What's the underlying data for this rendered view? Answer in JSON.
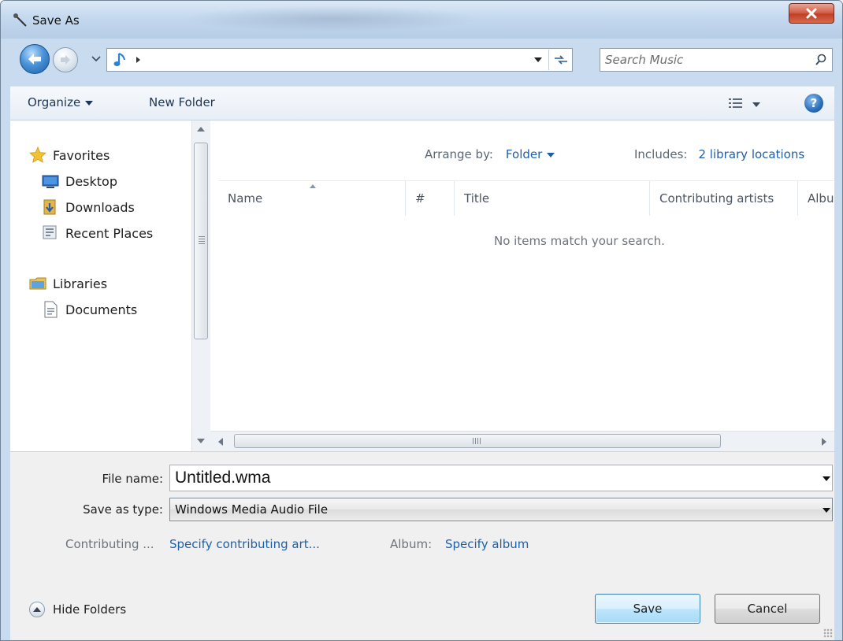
{
  "window": {
    "title": "Save As"
  },
  "address": {
    "search_placeholder": "Search Music"
  },
  "toolbar": {
    "organize_label": "Organize",
    "new_folder_label": "New Folder"
  },
  "navigation": {
    "items": [
      {
        "label": "Favorites",
        "icon": "star-icon"
      },
      {
        "label": "Desktop",
        "icon": "desktop-icon"
      },
      {
        "label": "Downloads",
        "icon": "downloads-icon"
      },
      {
        "label": "Recent Places",
        "icon": "recent-places-icon"
      },
      {
        "label": "Libraries",
        "icon": "libraries-icon"
      },
      {
        "label": "Documents",
        "icon": "documents-icon"
      }
    ]
  },
  "filelist": {
    "arrange_by_label": "Arrange by:",
    "arrange_by_value": "Folder",
    "includes_label": "Includes:",
    "includes_value": "2 library locations",
    "columns": [
      "Name",
      "#",
      "Title",
      "Contributing artists",
      "Album"
    ],
    "empty_message": "No items match your search."
  },
  "form": {
    "file_name_label": "File name:",
    "file_name_value": "Untitled.wma",
    "save_type_label": "Save as type:",
    "save_type_value": "Windows Media Audio File",
    "contributing_label": "Contributing ...",
    "contributing_link": "Specify contributing art...",
    "album_label": "Album:",
    "album_link": "Specify album"
  },
  "footer": {
    "hide_folders_label": "Hide Folders",
    "save_label": "Save",
    "cancel_label": "Cancel"
  },
  "colors": {
    "accent_link": "#1f5fa8",
    "close_red": "#c0402a",
    "frame": "#c9dcef"
  }
}
